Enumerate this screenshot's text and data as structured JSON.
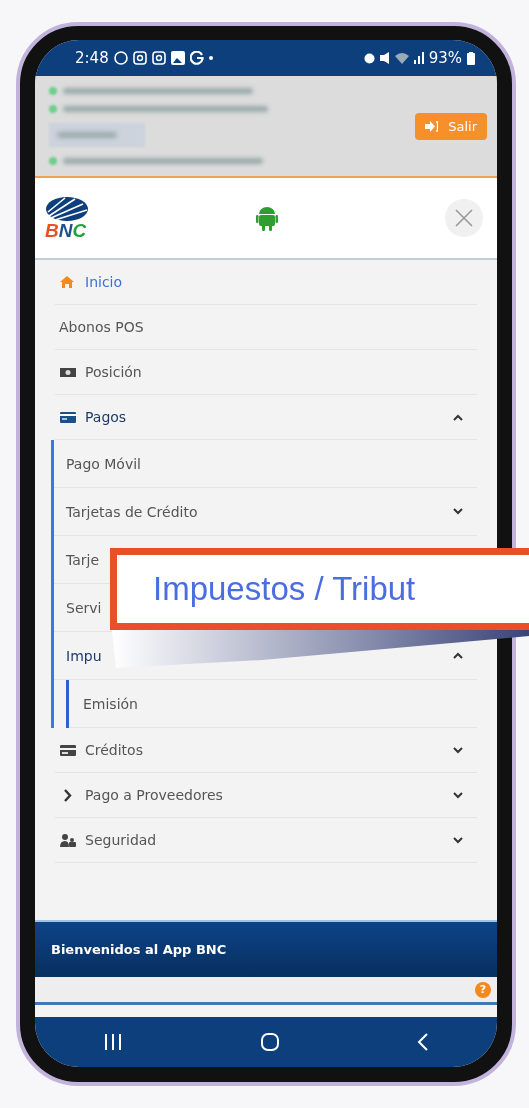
{
  "status_bar": {
    "time": "2:48",
    "battery": "93%"
  },
  "header": {
    "logout_button": "Salir"
  },
  "logo": {
    "text": "BNC"
  },
  "menu": [
    {
      "label": "Inicio",
      "active": true
    },
    {
      "label": "Abonos POS",
      "active": false
    },
    {
      "label": "Posición",
      "active": false
    },
    {
      "label": "Pagos",
      "active": false,
      "expanded": true,
      "children": [
        {
          "label": "Pago Móvil",
          "active": false
        },
        {
          "label": "Tarjetas de Crédito",
          "active": false,
          "expanded": false
        },
        {
          "label": "Tarje",
          "active": false
        },
        {
          "label": "Servi",
          "active": false
        },
        {
          "label": "Impu",
          "active": true,
          "expanded": true,
          "children": [
            {
              "label": "Emisión",
              "active": false
            }
          ]
        }
      ]
    },
    {
      "label": "Créditos",
      "active": false,
      "expanded": false
    },
    {
      "label": "Pago a Proveedores",
      "active": false,
      "expanded": false
    },
    {
      "label": "Seguridad",
      "active": false,
      "expanded": false
    }
  ],
  "banner": {
    "title": "Bienvenidos al App BNC"
  },
  "help": {
    "label": "?"
  },
  "callout": {
    "text": "Impuestos / Tribut"
  }
}
